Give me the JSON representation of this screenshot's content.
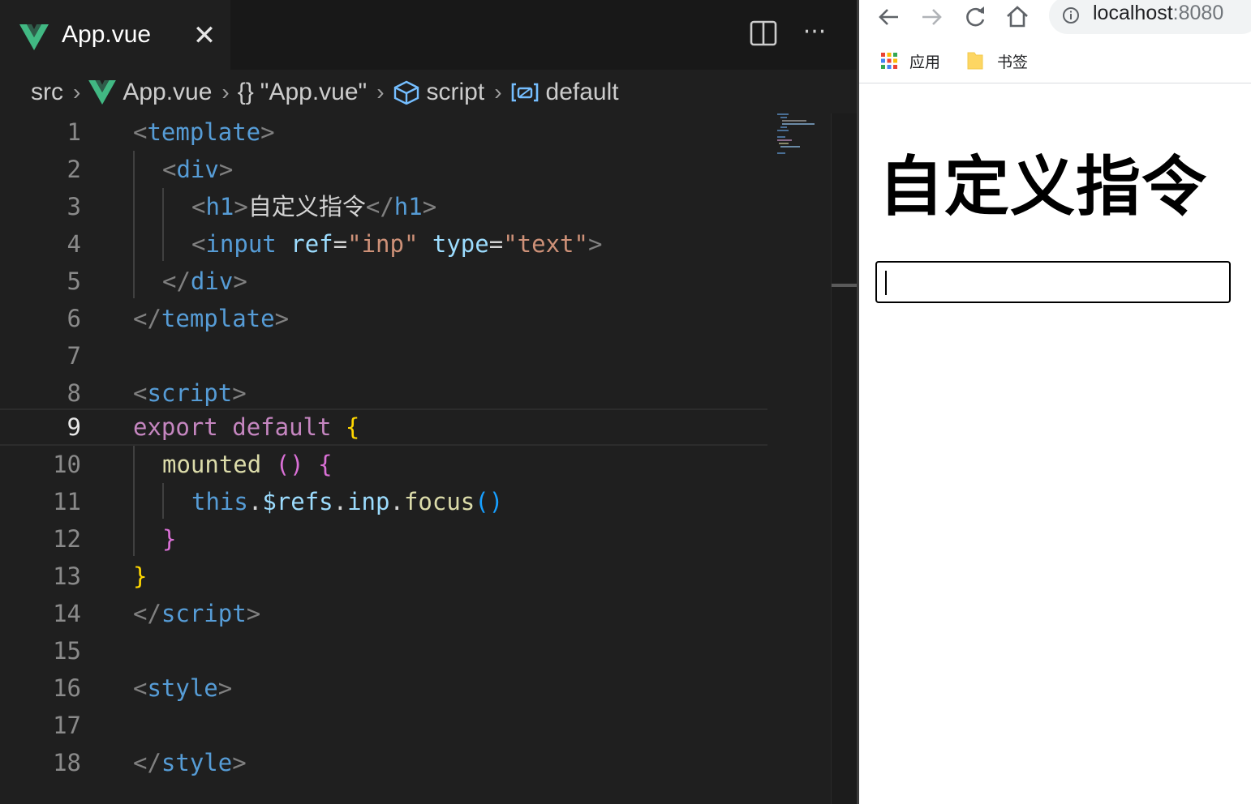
{
  "editor": {
    "tab": {
      "title": "App.vue",
      "close_glyph": "✕",
      "icon": "vue-icon"
    },
    "actions": {
      "split_icon": "split-editor-icon",
      "more_glyph": "···"
    },
    "breadcrumb": {
      "folder": "src",
      "file": "App.vue",
      "module": "\"App.vue\"",
      "module_braces": "{}",
      "section": "script",
      "symbol": "default"
    },
    "line_numbers": [
      "1",
      "2",
      "3",
      "4",
      "5",
      "6",
      "7",
      "8",
      "9",
      "10",
      "11",
      "12",
      "13",
      "14",
      "15",
      "16",
      "17",
      "18"
    ],
    "current_line": "9"
  },
  "code": {
    "l1": {
      "open": "<",
      "tag": "template",
      "close": ">"
    },
    "l2": {
      "open": "<",
      "tag": "div",
      "close": ">"
    },
    "l3": {
      "open": "<",
      "tag": "h1",
      "close": ">",
      "text": "自定义指令",
      "open2": "</",
      "tag2": "h1",
      "close2": ">"
    },
    "l4": {
      "open": "<",
      "tag": "input",
      "attr1": "ref",
      "eq1": "=",
      "val1": "\"inp\"",
      "attr2": "type",
      "eq2": "=",
      "val2": "\"text\"",
      "close": ">"
    },
    "l5": {
      "open": "</",
      "tag": "div",
      "close": ">"
    },
    "l6": {
      "open": "</",
      "tag": "template",
      "close": ">"
    },
    "l8": {
      "open": "<",
      "tag": "script",
      "close": ">"
    },
    "l9": {
      "kw1": "export",
      "kw2": "default",
      "brace": "{"
    },
    "l10": {
      "fn": "mounted",
      "parens": "()",
      "brace": "{"
    },
    "l11": {
      "this": "this",
      "dot1": ".",
      "refs": "$refs",
      "dot2": ".",
      "inp": "inp",
      "dot3": ".",
      "fn": "focus",
      "parens": "()"
    },
    "l12": {
      "brace": "}"
    },
    "l13": {
      "brace": "}"
    },
    "l14": {
      "open": "</",
      "tag": "script",
      "close": ">"
    },
    "l16": {
      "open": "<",
      "tag": "style",
      "close": ">"
    },
    "l18": {
      "open": "</",
      "tag": "style",
      "close": ">"
    }
  },
  "browser": {
    "url_host": "localhost",
    "url_port": ":8080",
    "bookmarks": [
      {
        "label": "应用",
        "icon": "apps-grid-icon"
      },
      {
        "label": "书签",
        "icon": "folder-icon"
      }
    ],
    "page": {
      "heading": "自定义指令",
      "input_value": ""
    }
  },
  "colors": {
    "editor_bg": "#1f1f1f",
    "tag": "#569cd6",
    "attr": "#9cdcfe",
    "string": "#ce9178",
    "keyword": "#c586c0",
    "function": "#dcdcaa",
    "vue_green": "#41b883"
  }
}
